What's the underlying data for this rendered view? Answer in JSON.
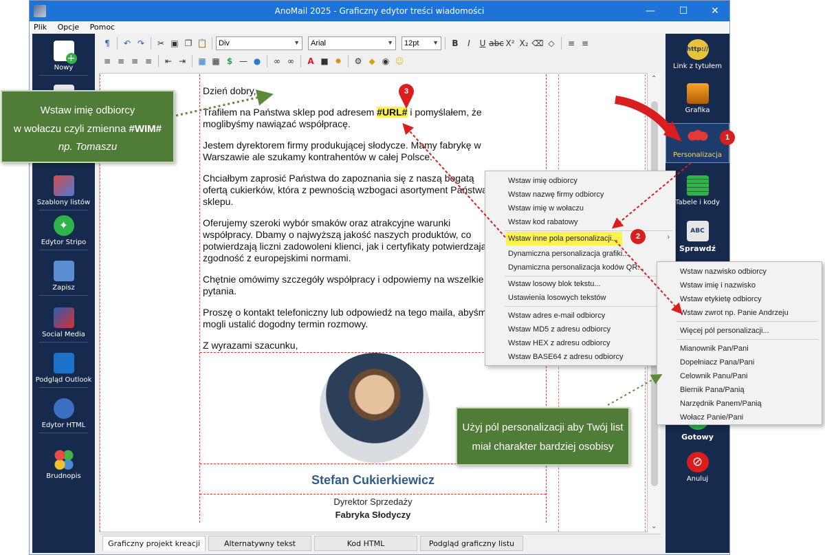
{
  "window": {
    "title": "AnoMail 2025 - Graficzny edytor treści wiadomości"
  },
  "menubar": [
    "Plik",
    "Opcje",
    "Pomoc"
  ],
  "left_sidebar": [
    "Nowy",
    "Szablony listów",
    "Edytor Stripo",
    "Zapisz",
    "Social Media",
    "Podgląd Outlook",
    "Edytor HTML",
    "Brudnopis"
  ],
  "right_sidebar": [
    "Link z tytułem",
    "Grafika",
    "Personalizacja",
    "Tabele i kody",
    "Sprawdź",
    "Gotowy",
    "Anuluj"
  ],
  "toolbar": {
    "block": "Div",
    "font": "Arial",
    "size": "12pt"
  },
  "letter": {
    "greeting": "Dzień dobry,",
    "p1_a": "Trafiłem na Państwa sklep pod adresem ",
    "p1_tag": "#URL#",
    "p1_b": " i pomyślałem, że moglibyśmy nawiązać współpracę.",
    "p2": "Jestem dyrektorem firmy produkującej słodycze. Mamy fabrykę w Warszawie ale szukamy kontrahentów w całej Polsce.",
    "p3": "Chciałbym zaprosić Państwa do zapoznania się z naszą bogatą ofertą cukierków, która z pewnością wzbogaci asortyment Państwa sklepu.",
    "p4": "Oferujemy szeroki wybór smaków oraz atrakcyjne warunki współpracy. Dbamy o najwyższą jakość naszych produktów, co potwierdzają liczni zadowoleni klienci, jak i certyfikaty potwierdzające zgodność z europejskimi normami.",
    "p5": "Chętnie omówimy szczegóły współpracy i odpowiemy na wszelkie pytania.",
    "p6": "Proszę o kontakt telefoniczny lub odpowiedź na tego maila, abyśmy mogli ustalić dogodny termin rozmowy.",
    "closing": "Z wyrazami szacunku,",
    "sig_name": "Stefan Cukierkiewicz",
    "sig_role": "Dyrektor Sprzedaży",
    "sig_company": "Fabryka Słodyczy"
  },
  "tabs": [
    "Graficzny projekt kreacji",
    "Alternatywny tekst",
    "Kod HTML",
    "Podgląd graficzny listu"
  ],
  "context_menu": [
    "Wstaw imię odbiorcy",
    "Wstaw nazwę firmy odbiorcy",
    "Wstaw imię w wołaczu",
    "Wstaw kod rabatowy",
    "Wstaw inne pola personalizacji...",
    "Dynamiczna personalizacja grafiki...",
    "Dynamiczna personalizacja kodów QR...",
    "Wstaw losowy blok tekstu...",
    "Ustawienia losowych tekstów",
    "Wstaw adres e-mail odbiorcy",
    "Wstaw MD5 z adresu odbiorcy",
    "Wstaw HEX z adresu odbiorcy",
    "Wstaw BASE64 z adresu odbiorcy"
  ],
  "submenu": [
    "Wstaw nazwisko odbiorcy",
    "Wstaw imię i nazwisko",
    "Wstaw etykietę odbiorcy",
    "Wstaw zwrot np. Panie Andrzeju",
    "Więcej pól personalizacji...",
    "Mianownik Pan/Pani",
    "Dopełniacz Pana/Pani",
    "Celownik Panu/Pani",
    "Biernik Pana/Panią",
    "Narzędnik Panem/Panią",
    "Wołacz Panie/Pani"
  ],
  "callout_left": {
    "line1": "Wstaw imię odbiorcy",
    "line2a": "w wołaczu czyli zmienna ",
    "line2b": "#WIM#",
    "line3": "np. Tomaszu"
  },
  "callout_right": {
    "line1": "Użyj pól personalizacji aby Twój list",
    "line2": "miał charakter bardziej osobisy"
  },
  "badges": [
    "1",
    "2",
    "3"
  ],
  "colors": {
    "titlebar": "#1e73d8",
    "sidebar": "#152a4c",
    "highlight": "#fbf24b",
    "callout": "#4f7c36",
    "accent_red": "#d81e1e"
  }
}
